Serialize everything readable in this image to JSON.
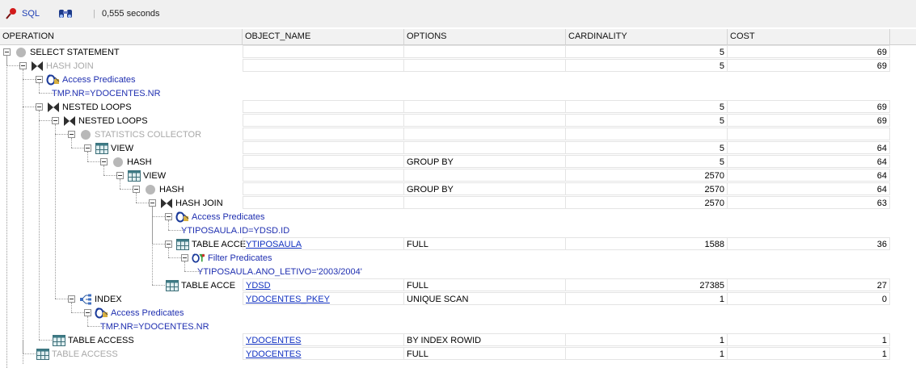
{
  "toolbar": {
    "sql_label": "SQL",
    "elapsed": "0,555 seconds",
    "pin_icon": "pin-icon",
    "explain_icon": "binoculars-icon"
  },
  "columns": [
    "OPERATION",
    "OBJECT_NAME",
    "OPTIONS",
    "CARDINALITY",
    "COST"
  ],
  "rows": [
    {
      "label": "SELECT STATEMENT",
      "icon": "circle-icon",
      "cardinality": "5",
      "cost": "69"
    },
    {
      "label": "HASH JOIN",
      "icon": "join-icon",
      "cardinality": "5",
      "cost": "69"
    },
    {
      "label": "Access Predicates",
      "icon": "predicate-icon"
    },
    {
      "label": "TMP.NR=YDOCENTES.NR"
    },
    {
      "label": "NESTED LOOPS",
      "icon": "join-icon",
      "cardinality": "5",
      "cost": "69"
    },
    {
      "label": "NESTED LOOPS",
      "icon": "join-icon",
      "cardinality": "5",
      "cost": "69"
    },
    {
      "label": "STATISTICS COLLECTOR",
      "icon": "circle-icon"
    },
    {
      "label": "VIEW",
      "icon": "table-icon",
      "cardinality": "5",
      "cost": "64"
    },
    {
      "label": "HASH",
      "icon": "circle-icon",
      "options": "GROUP BY",
      "cardinality": "5",
      "cost": "64"
    },
    {
      "label": "VIEW",
      "icon": "table-icon",
      "cardinality": "2570",
      "cost": "64"
    },
    {
      "label": "HASH",
      "icon": "circle-icon",
      "options": "GROUP BY",
      "cardinality": "2570",
      "cost": "64"
    },
    {
      "label": "HASH JOIN",
      "icon": "join-icon",
      "cardinality": "2570",
      "cost": "63"
    },
    {
      "label": "Access Predicates",
      "icon": "predicate-icon"
    },
    {
      "label": "YTIPOSAULA.ID=YDSD.ID"
    },
    {
      "label": "TABLE ACCE",
      "icon": "table-icon",
      "object": "YTIPOSAULA",
      "options": "FULL",
      "cardinality": "1588",
      "cost": "36"
    },
    {
      "label": "Filter Predicates",
      "icon": "filter-icon"
    },
    {
      "label": "YTIPOSAULA.ANO_LETIVO='2003/2004'"
    },
    {
      "label": "TABLE ACCE",
      "icon": "table-icon",
      "object": "YDSD",
      "options": "FULL",
      "cardinality": "27385",
      "cost": "27"
    },
    {
      "label": "INDEX",
      "icon": "index-icon",
      "object": "YDOCENTES_PKEY",
      "options": "UNIQUE SCAN",
      "cardinality": "1",
      "cost": "0"
    },
    {
      "label": "Access Predicates",
      "icon": "predicate-icon"
    },
    {
      "label": "TMP.NR=YDOCENTES.NR"
    },
    {
      "label": "TABLE ACCESS",
      "icon": "table-icon",
      "object": "YDOCENTES",
      "options": "BY INDEX ROWID",
      "cardinality": "1",
      "cost": "1"
    },
    {
      "label": "TABLE ACCESS",
      "icon": "table-icon",
      "object": "YDOCENTES",
      "options": "FULL",
      "cardinality": "1",
      "cost": "1"
    }
  ]
}
